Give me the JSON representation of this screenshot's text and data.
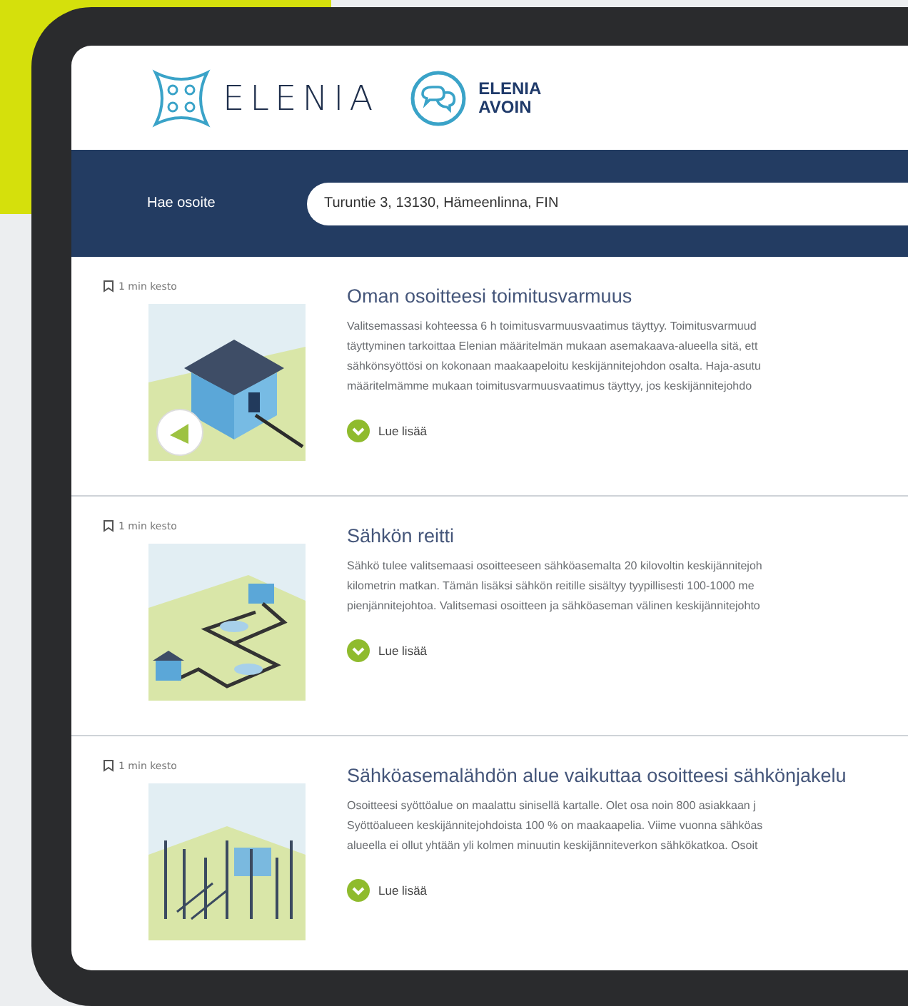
{
  "header": {
    "brand": "ELENIA",
    "sub_brand_lines": [
      "ELENIA",
      "AVOIN"
    ]
  },
  "search": {
    "label": "Hae osoite",
    "value": "Turuntie 3, 13130, Hämeenlinna, FIN"
  },
  "articles": [
    {
      "meta": "1 min kesto",
      "kind": "house",
      "title": "Oman osoitteesi toimitusvarmuus",
      "body_lines": [
        "Valitsemassasi kohteessa 6 h toimitusvarmuusvaatimus täyttyy. Toimitusvarmuud",
        "täyttyminen tarkoittaa Elenian määritelmän mukaan asemakaava-alueella sitä, ett",
        "sähkönsyöttösi on kokonaan maakaapeloitu keskijännitejohdon osalta. Haja-asutu",
        "määritelmämme mukaan toimitusvarmuusvaatimus täyttyy, jos keskijännitejohdo"
      ],
      "link": "Lue lisää"
    },
    {
      "meta": "1 min kesto",
      "kind": "route",
      "title": "Sähkön reitti",
      "body_lines": [
        "Sähkö tulee valitsemaasi osoitteeseen sähköasemalta 20 kilovoltin keskijännitejoh",
        "kilometrin matkan. Tämän lisäksi sähkön reitille sisältyy tyypillisesti 100-1000 me",
        "pienjännitejohtoa. Valitsemasi osoitteen ja sähköaseman välinen keskijännitejohto"
      ],
      "link": "Lue lisää"
    },
    {
      "meta": "1 min kesto",
      "kind": "substation",
      "title": "Sähköasemalähdön alue vaikuttaa osoitteesi sähkönjakelu",
      "body_lines": [
        "Osoitteesi syöttöalue on maalattu sinisellä kartalle. Olet osa noin 800 asiakkaan j",
        "Syöttöalueen keskijännitejohdoista 100 % on maakaapelia. Viime vuonna sähköas",
        "alueella ei ollut yhtään yli kolmen minuutin keskijänniteverkon sähkökatkoa. Osoit"
      ],
      "link": "Lue lisää"
    }
  ]
}
